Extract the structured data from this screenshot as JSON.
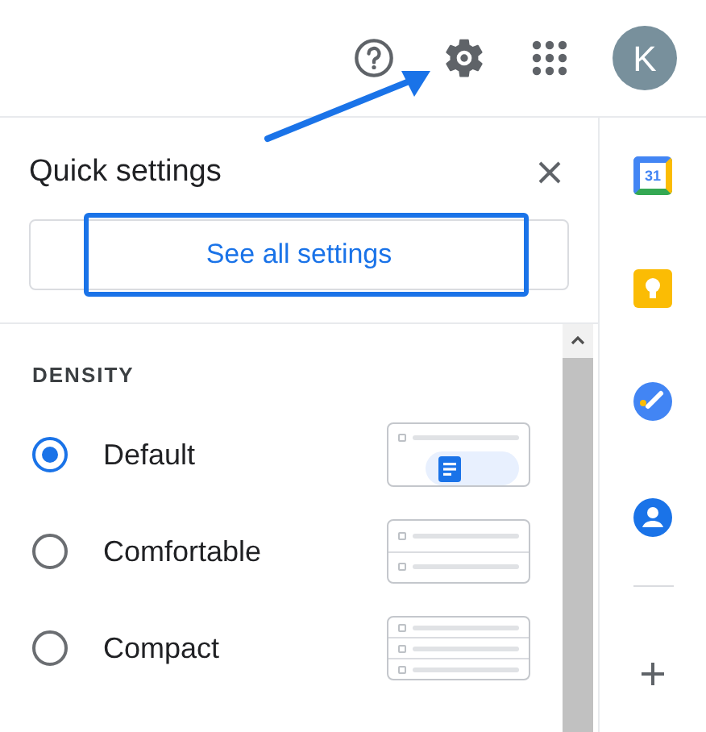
{
  "top_bar": {
    "avatar_letter": "K"
  },
  "quick_settings": {
    "title": "Quick settings",
    "see_all_button": "See all settings",
    "highlighted": true,
    "density": {
      "heading": "DENSITY",
      "options": [
        {
          "label": "Default",
          "kind": "default",
          "selected": true
        },
        {
          "label": "Comfortable",
          "kind": "comfortable",
          "selected": false
        },
        {
          "label": "Compact",
          "kind": "compact",
          "selected": false
        }
      ]
    }
  },
  "side_panel": {
    "calendar_date": "31"
  }
}
